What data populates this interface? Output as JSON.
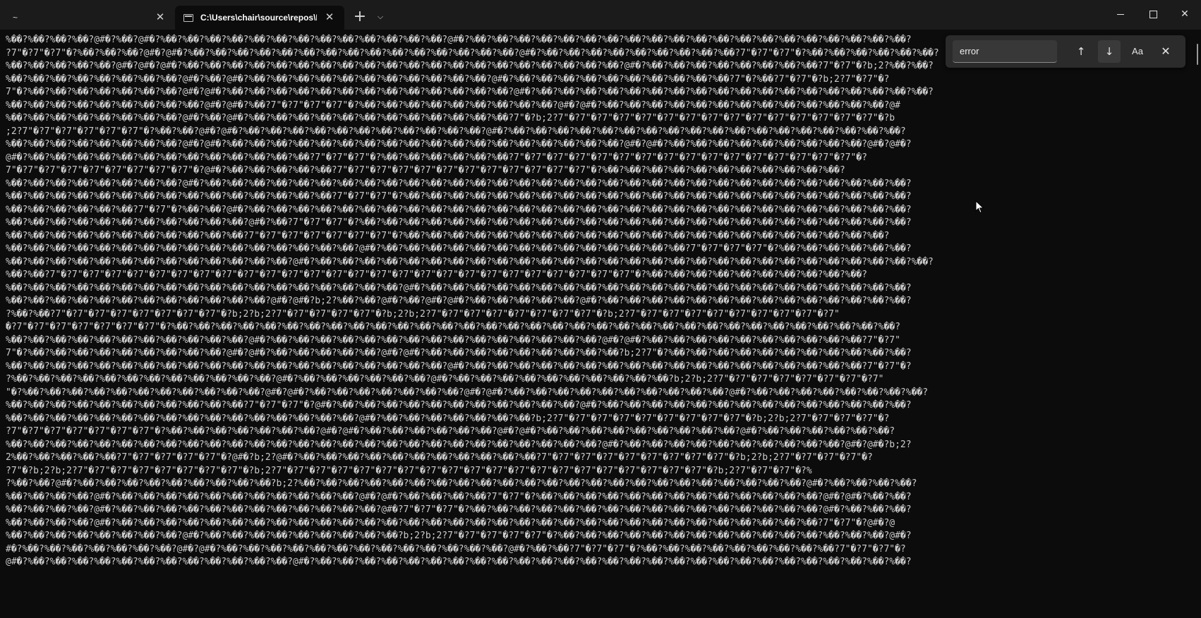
{
  "tabs": [
    {
      "title": "~",
      "active": false,
      "close_glyph": "✕"
    },
    {
      "title": "C:\\Users\\chair\\source\\repos\\N",
      "active": true,
      "icon": "console-icon",
      "close_glyph": "✕"
    }
  ],
  "tabbar": {
    "new_tab_glyph": "+",
    "dropdown_glyph": "⌵"
  },
  "window_controls": {
    "close_glyph": "✕"
  },
  "search": {
    "query": "error",
    "prev_glyph": "↑",
    "next_glyph": "↓",
    "case_label": "Aa",
    "close_glyph": "✕"
  },
  "terminal": {
    "lines": [
      "%��?%��?%��?%��?@#�?%��?@#�?%��?%��?%��?%��?%��?%��?%��?%��?%��?%��?%��?%��?%��?@#�?%��?%��?%��?%��?%��?%��?%��?%��?%��?%��?%��?%��?%��?%��?%��?%��?%��?%��?%��?%��?",
      "?7\"�?7\"�?7\"�?%��?%��?%��?@#�?@#�?%��?%��?%��?%��?%��?%��?%��?%��?%��?%��?%��?%��?%��?%��?%��?@#�?%��?%��?%��?%��?%��?%��?%��?%��?%��?7\"�?7\"�?7\"�?%��?%��?%��?%��?%��?%��?",
      "%��?%��?%��?%��?%��?@#�?@#�?@#�?%��?%��?%��?%��?%��?%��?%��?%��?%��?%��?%��?%��?%��?%��?%��?%��?%��?%��?%��?%��?@#�?%��?%��?%��?%��?%��?%��?%��?%��?7\"�?7\"�?b;2?%��?%��?",
      "%��?%��?%��?%��?%��?%��?%��?%��?@#�?%��?@#�?%��?%��?%��?%��?%��?%��?%��?%��?%��?%��?%��?@#�?%��?%��?%��?%��?%��?%��?%��?%��?%��?%��?7\"�?%��?7\"�?7\"�?b;2?7\"�?7\"�?",
      "7\"�?%��?%��?%��?%��?%��?%��?%��?@#�?@#�?%��?%��?%��?%��?%��?%��?%��?%��?%��?%��?%��?%��?%��?@#�?%��?%��?%��?%��?%��?%��?%��?%��?%��?%��?%��?%��?%��?%��?%��?%��?%��?%��?",
      "%��?%��?%��?%��?%��?%��?%��?%��?%��?@#�?@#�?%��?7\"�?7\"�?7\"�?7\"�?%��?%��?%��?%��?%��?%��?%��?%��?%��?@#�?@#�?%��?%��?%��?%��?%��?%��?%��?%��?%��?%��?%��?%��?%��?@#",
      "%��?%��?%��?%��?%��?%��?%��?%��?@#�?%��?@#�?%��?%��?%��?%��?%��?%��?%��?%��?%��?%��?%��?%��?7\"�?b;2?7\"�?7\"�?7\"�?7\"�?7\"�?7\"�?7\"�?7\"�?7\"�?7\"�?7\"�?7\"�?7\"�?7\"�?7\"�?b",
      ";2?7\"�?7\"�?7\"�?7\"�?7\"�?7\"�?%��?%��?@#�?@#�?%��?%��?%��?%��?%��?%��?%��?%��?%��?%��?%��?@#�?%��?%��?%��?%��?%��?%��?%��?%��?%��?%��?%��?%��?%��?%��?%��?%��?%��?%��?",
      "%��?%��?%��?%��?%��?%��?%��?%��?@#�?@#�?%��?%��?%��?%��?%��?%��?%��?%��?%��?%��?%��?%��?%��?%��?%��?%��?%��?%��?@#�?@#�?%��?%��?%��?%��?%��?%��?%��?%��?%��?@#�?@#�?",
      "@#�?%��?%��?%��?%��?%��?%��?%��?%��?%��?%��?%��?%��?%��?7\"�?7\"�?7\"�?%��?%��?%��?%��?%��?%��?7\"�?7\"�?7\"�?7\"�?7\"�?7\"�?7\"�?7\"�?7\"�?7\"�?7\"�?7\"�?7\"�?7\"�?7\"�?7\"�?",
      "7\"�?7\"�?7\"�?7\"�?7\"�?7\"�?7\"�?7\"�?7\"�?@#�?%��?%��?%��?%��?%��?7\"�?7\"�?7\"�?7\"�?7\"�?7\"�?7\"�?7\"�?7\"�?7\"�?7\"�?7\"�?%��?%��?%��?%��?%��?%��?%��?%��?%��?%��?%��?",
      "%��?%��?%��?%��?%��?%��?%��?%��?@#�?%��?%��?%��?%��?%��?%��?%��?%��?%��?%��?%��?%��?%��?%��?%��?%��?%��?%��?%��?%��?%��?%��?%��?%��?%��?%��?%��?%��?%��?%��?%��?%��?",
      "%��?%��?%��?%��?%��?%��?%��?%��?%��?%��?%��?%��?%��?%��?%��?7\"�?7\"�?7\"�?%��?%��?%��?%��?%��?%��?%��?%��?%��?%��?%��?%��?%��?%��?%��?%��?%��?%��?%��?%��?%��?%��?%��?",
      "%��?%��?%��?%��?%��?%��?7\"�?7\"�?%��?%��?@#�?%��?%��?%��?%��?%��?%��?%��?%��?%��?%��?%��?%��?%��?%��?%��?%��?%��?%��?%��?%��?%��?%��?%��?%��?%��?%��?%��?%��?%��?%��?",
      "%��?%��?%��?%��?%��?%��?%��?%��?%��?%��?%��?@#�?%��?7\"�?7\"�?7\"�?%��?%��?%��?%��?%��?%��?%��?%��?%��?%��?%��?%��?%��?%��?%��?%��?%��?%��?%��?%��?%��?%��?%��?%��?%��?",
      "%��?%��?%��?%��?%��?%��?%��?%��?%��?%��?%��?7\"�?7\"�?7\"�?7\"�?7\"�?7\"�?7\"�?%��?%��?%��?%��?%��?%��?%��?%��?%��?%��?%��?%��?%��?%��?%��?%��?%��?%��?%��?%��?%��?%��?",
      "%��?%��?%��?%��?%��?%��?%��?%��?%��?%��?%��?%��?%��?%��?%��?%��?@#�?%��?%��?%��?%��?%��?%��?%��?%��?%��?%��?%��?%��?%��?%��?7\"�?7\"�?7\"�?7\"�?%��?%��?%��?%��?%��?%��?",
      "%��?%��?%��?%��?%��?%��?%��?%��?%��?%��?%��?%��?%��?@#�?%��?%��?%��?%��?%��?%��?%��?%��?%��?%��?%��?%��?%��?%��?%��?%��?%��?%��?%��?%��?%��?%��?%��?%��?%��?%��?%��?%��?",
      "%��?%��?7\"�?7\"�?7\"�?7\"�?7\"�?7\"�?7\"�?7\"�?7\"�?7\"�?7\"�?7\"�?7\"�?7\"�?7\"�?7\"�?7\"�?7\"�?7\"�?7\"�?7\"�?7\"�?7\"�?7\"�?7\"�?7\"�?7\"�?%��?%��?%��?%��?%��?%��?%��?%��?%��?%��?",
      "%��?%��?%��?%��?%��?%��?%��?%��?%��?%��?%��?%��?%��?%��?%��?%��?%��?%��?@#�?%��?%��?%��?%��?%��?%��?%��?%��?%��?%��?%��?%��?%��?%��?%��?%��?%��?%��?%��?%��?%��?%��?",
      "%��?%��?%��?%��?%��?%��?%��?%��?%��?%��?%��?%��?@#�?@#�?b;2?%��?%��?@#�?%��?@#�?@#�?%��?%��?%��?%��?%��?@#�?%��?%��?%��?%��?%��?%��?%��?%��?%��?%��?%��?%��?%��?%��?",
      "?%��?%��?7\"�?7\"�?7\"�?7\"�?7\"�?7\"�?7\"�?7\"�?b;2?b;2?7\"�?7\"�?7\"�?7\"�?7\"�?b;2?b;2?7\"�?7\"�?7\"�?7\"�?7\"�?7\"�?7\"�?7\"�?b;2?7\"�?7\"�?7\"�?7\"�?7\"�?7\"�?7\"�?7\"�?7\"�?7\"",
      "�?7\"�?7\"�?7\"�?7\"�?7\"�?7\"�?7\"�?%��?%��?%��?%��?%��?%��?%��?%��?%��?%��?%��?%��?%��?%��?%��?%��?%��?%��?%��?%��?%��?%��?%��?%��?%��?%��?%��?%��?%��?%��?%��?%��?%��?",
      "%��?%��?%��?%��?%��?%��?%��?%��?%��?%��?%��?@#�?%��?%��?%��?%��?%��?%��?%��?%��?%��?%��?%��?%��?%��?%��?%��?@#�?@#�?%��?%��?%��?%��?%��?%��?%��?%��?%��?%��?7\"�?7\"",
      "7\"�?%��?%��?%��?%��?%��?%��?%��?%��?%��?@#�?@#�?%��?%��?%��?%��?%��?@#�?@#�?%��?%��?%��?%��?%��?%��?%��?%��?%��?b;2?7\"�?%��?%��?%��?%��?%��?%��?%��?%��?%��?%��?%��?",
      "%��?%��?%��?%��?%��?%��?%��?%��?%��?%��?%��?%��?%��?%��?%��?%��?%��?%��?%��?%��?@#�?%��?%��?%��?%��?%��?%��?%��?%��?%��?%��?%��?%��?%��?%��?%��?%��?%��?%��?7\"�?7\"�?",
      "?%��?%��?%��?%��?%��?%��?%��?%��?%��?%��?%��?%��?@#�?%��?%��?%��?%��?%��?%��?@#�?%��?%��?%��?%��?%��?%��?%��?%��?%��?%��?b;2?b;2?7\"�?7\"�?7\"�?7\"�?7\"�?7\"�?7\"�?7\"",
      "\"�?%��?%��?%��?%��?%��?%��?%��?%��?%��?%��?%��?@#�?@#�?%��?%��?%��?%��?%��?%��?%��?@#�?@#�?%��?%��?%��?%��?%��?%��?%��?%��?%��?%��?@#�?%��?%��?%��?%��?%��?%��?%��?%��?",
      "%��?%��?%��?%��?%��?%��?%��?%��?%��?%��?%��?7\"�?7\"�?7\"�?@#�?%��?%��?%��?%��?%��?%��?%��?%��?%��?%��?%��?@#�?%��?%��?%��?%��?%��?%��?%��?%��?%��?%��?%��?%��?%��?%��?",
      "%��?%��?%��?%��?%��?%��?%��?%��?%��?%��?%��?%��?%��?%��?%��?%��?@#�?%��?%��?%��?%��?%��?%��?%��?b;2?7\"�?7\"�?7\"�?7\"�?7\"�?7\"�?7\"�?7\"�?7\"�?b;2?b;2?7\"�?7\"�?7\"�?7\"�?",
      "?7\"�?7\"�?7\"�?7\"�?7\"�?7\"�?7\"�?%��?%��?%��?%��?%��?%��?%��?@#�?@#�?%��?%��?%��?%��?%��?%��?@#�?@#�?%��?%��?%��?%��?%��?%��?%��?%��?%��?@#�?%��?%��?%��?%��?%��?%��?",
      "%��?%��?%��?%��?%��?%��?%��?%��?%��?%��?%��?%��?%��?%��?%��?%��?%��?%��?%��?%��?%��?%��?%��?%��?%��?%��?%��?@#�?%��?%��?%��?%��?%��?%��?%��?%��?%��?%��?@#�?@#�?b;2?",
      "2%��?%��?%��?%��?%��?7\"�?7\"�?7\"�?7\"�?7\"�?@#�?b;2?@#�?%��?%��?%��?%��?%��?%��?%��?%��?%��?%��?%��?7\"�?7\"�?7\"�?7\"�?7\"�?7\"�?7\"�?7\"�?7\"�?b;2?b;2?7\"�?7\"�?7\"�?7\"�?",
      "?7\"�?b;2?b;2?7\"�?7\"�?7\"�?7\"�?7\"�?7\"�?7\"�?7\"�?b;2?7\"�?7\"�?7\"�?7\"�?7\"�?7\"�?7\"�?7\"�?7\"�?7\"�?7\"�?7\"�?7\"�?7\"�?7\"�?7\"�?7\"�?7\"�?7\"�?7\"�?b;2?7\"�?7\"�?7\"�?%",
      "?%��?%��?@#�?%��?%��?%��?%��?%��?%��?%��?%��?%��?b;2?%��?%��?%��?%��?%��?%��?%��?%��?%��?%��?%��?%��?%��?%��?%��?%��?%��?%��?%��?%��?%��?%��?%��?@#�?%��?%��?%��?%��?",
      "%��?%��?%��?%��?@#�?%��?%��?%��?%��?%��?%��?%��?%��?%��?%��?%��?@#�?@#�?%��?%��?%��?%��?7\"�?7\"�?%��?%��?%��?%��?%��?%��?%��?%��?%��?%��?%��?%��?%��?@#�?@#�?%��?%��?",
      "%��?%��?%��?%��?@#�?%��?%��?%��?%��?%��?%��?%��?%��?%��?%��?%��?%��?@#�?7\"�?7\"�?7\"�?%��?%��?%��?%��?%��?%��?%��?%��?%��?%��?%��?%��?%��?%��?%��?%��?@#�?%��?%��?%��?",
      "%��?%��?%��?%��?@#�?%��?%��?%��?%��?%��?%��?%��?%��?%��?%��?%��?%��?%��?%��?%��?%��?%��?%��?%��?%��?%��?%��?%��?%��?%��?%��?%��?%��?%��?%��?%��?%��?7\"�?7\"�?@#�?@",
      "%��?%��?%��?%��?%��?%��?%��?%��?@#�?%��?%��?%��?%��?%��?%��?%��?%��?%��?b;2?b;2?7\"�?7\"�?7\"�?7\"�?7\"�?%��?%��?%��?%��?%��?%��?%��?%��?%��?%��?%��?%��?%��?%��?%��?@#�?",
      "#�?%��?%��?%��?%��?%��?%��?%��?@#�?@#�?%��?%��?%��?%��?%��?%��?%��?%��?%��?%��?%��?%��?%��?@#�?%��?%��?7\"�?7\"�?7\"�?%��?%��?%��?%��?%��?%��?%��?%��?%��?7\"�?7\"�?7\"�?",
      "@#�?%��?%��?%��?%��?%��?%��?%��?%��?%��?%��?%��?%��?@#�?%��?%��?%��?%��?%��?%��?%��?%��?%��?%��?%��?%��?%��?%��?%��?%��?%��?%��?%��?%��?%��?%��?%��?%��?%��?%��?%��?"
    ]
  }
}
